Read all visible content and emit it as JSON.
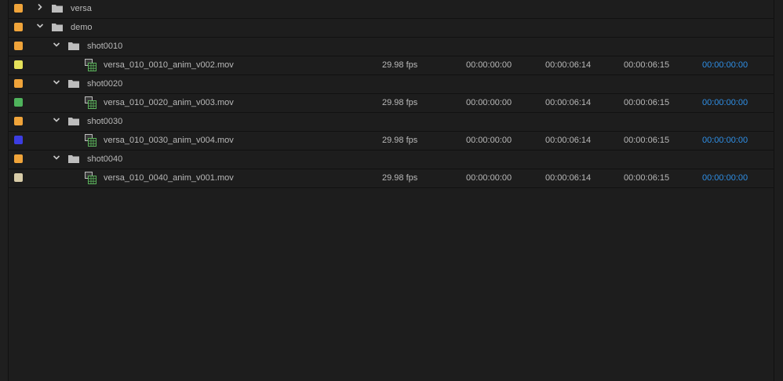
{
  "colors": {
    "background": "#1d1d1d",
    "row_divider": "#111111",
    "text": "#b9b9b9",
    "timecode_link": "#2f8fe6",
    "folder_icon": "#bdbdbd",
    "clip_icon": "#5bb25b"
  },
  "rows": [
    {
      "type": "bin",
      "name": "versa",
      "expanded": false,
      "depth": 0,
      "label_color": "#f0a43a"
    },
    {
      "type": "bin",
      "name": "demo",
      "expanded": true,
      "depth": 0,
      "label_color": "#f0a43a"
    },
    {
      "type": "bin",
      "name": "shot0010",
      "expanded": true,
      "depth": 1,
      "label_color": "#f0a43a"
    },
    {
      "type": "clip",
      "name": "versa_010_0010_anim_v002.mov",
      "depth": 2,
      "label_color": "#e5e25a",
      "fps": "29.98 fps",
      "media_start": "00:00:00:00",
      "media_end": "00:00:06:14",
      "media_duration": "00:00:06:15",
      "video_in": "00:00:00:00"
    },
    {
      "type": "bin",
      "name": "shot0020",
      "expanded": true,
      "depth": 1,
      "label_color": "#f0a43a"
    },
    {
      "type": "clip",
      "name": "versa_010_0020_anim_v003.mov",
      "depth": 2,
      "label_color": "#4fb35c",
      "fps": "29.98 fps",
      "media_start": "00:00:00:00",
      "media_end": "00:00:06:14",
      "media_duration": "00:00:06:15",
      "video_in": "00:00:00:00"
    },
    {
      "type": "bin",
      "name": "shot0030",
      "expanded": true,
      "depth": 1,
      "label_color": "#f0a43a"
    },
    {
      "type": "clip",
      "name": "versa_010_0030_anim_v004.mov",
      "depth": 2,
      "label_color": "#3c3de2",
      "fps": "29.98 fps",
      "media_start": "00:00:00:00",
      "media_end": "00:00:06:14",
      "media_duration": "00:00:06:15",
      "video_in": "00:00:00:00"
    },
    {
      "type": "bin",
      "name": "shot0040",
      "expanded": true,
      "depth": 1,
      "label_color": "#f0a43a"
    },
    {
      "type": "clip",
      "name": "versa_010_0040_anim_v001.mov",
      "depth": 2,
      "label_color": "#d8cca8",
      "fps": "29.98 fps",
      "media_start": "00:00:00:00",
      "media_end": "00:00:06:14",
      "media_duration": "00:00:06:15",
      "video_in": "00:00:00:00"
    }
  ]
}
